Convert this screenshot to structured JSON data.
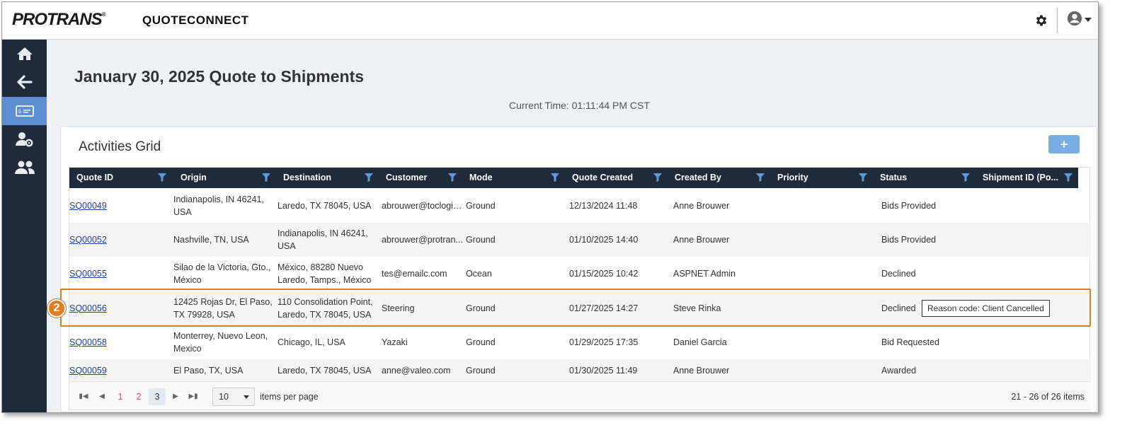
{
  "app": {
    "logo": "PROTRANS",
    "logo_mark": "®",
    "title": "QUOTECONNECT"
  },
  "page": {
    "title": "January 30, 2025 Quote to Shipments",
    "current_time": "Current Time: 01:11:44 PM CST"
  },
  "sidebar": {
    "items": [
      {
        "icon": "home-icon"
      },
      {
        "icon": "arrow-left-icon"
      },
      {
        "icon": "quote-card-icon",
        "active": true
      },
      {
        "icon": "user-settings-icon"
      },
      {
        "icon": "users-icon"
      }
    ]
  },
  "grid": {
    "title": "Activities Grid",
    "add_label": "+",
    "columns": [
      "Quote ID",
      "Origin",
      "Destination",
      "Customer",
      "Mode",
      "Quote Created",
      "Created By",
      "Priority",
      "Status",
      "Shipment ID (Po..."
    ],
    "rows": [
      {
        "quote_id": "SQ00049",
        "origin": "Indianapolis, IN 46241, USA",
        "destination": "Laredo, TX 78045, USA",
        "customer": "abrouwer@toclogis...",
        "mode": "Ground",
        "quote_created": "12/13/2024 11:48",
        "created_by": "Anne Brouwer",
        "priority": "",
        "status": "Bids Provided",
        "shipment_id": ""
      },
      {
        "quote_id": "SQ00052",
        "origin": "Nashville, TN, USA",
        "destination": "Indianapolis, IN 46241, USA",
        "customer": "abrouwer@protran...",
        "mode": "Ground",
        "quote_created": "01/10/2025 14:40",
        "created_by": "Anne Brouwer",
        "priority": "",
        "status": "Bids Provided",
        "shipment_id": ""
      },
      {
        "quote_id": "SQ00055",
        "origin": "Silao de la Victoria, Gto., México",
        "destination": "México, 88280 Nuevo Laredo, Tamps., México",
        "customer": "tes@emailc.com",
        "mode": "Ocean",
        "quote_created": "01/15/2025 10:42",
        "created_by": "ASPNET Admin",
        "priority": "",
        "status": "Declined",
        "shipment_id": ""
      },
      {
        "quote_id": "SQ00056",
        "origin": "12425 Rojas Dr, El Paso, TX 79928, USA",
        "destination": "110 Consolidation Point, Laredo, TX 78045, USA",
        "customer": "Steering",
        "mode": "Ground",
        "quote_created": "01/27/2025 14:27",
        "created_by": "Steve Rinka",
        "priority": "",
        "status": "Declined",
        "shipment_id": "",
        "tooltip": "Reason code: Client Cancelled"
      },
      {
        "quote_id": "SQ00058",
        "origin": "Monterrey, Nuevo Leon, Mexico",
        "destination": "Chicago, IL, USA",
        "customer": "Yazaki",
        "mode": "Ground",
        "quote_created": "01/29/2025 17:35",
        "created_by": "Daniel Garcia",
        "priority": "",
        "status": "Bid Requested",
        "shipment_id": ""
      },
      {
        "quote_id": "SQ00059",
        "origin": "El Paso, TX, USA",
        "destination": "Laredo, TX 78045, USA",
        "customer": "anne@valeo.com",
        "mode": "Ground",
        "quote_created": "01/30/2025 11:49",
        "created_by": "Anne Brouwer",
        "priority": "",
        "status": "Awarded",
        "shipment_id": ""
      }
    ]
  },
  "pager": {
    "pages": [
      "1",
      "2",
      "3"
    ],
    "current_page": "3",
    "page_size": "10",
    "per_page_label": "items per page",
    "range": "21 - 26 of 26 items"
  },
  "callout": {
    "number": "2",
    "color": "#e07d22"
  },
  "colors": {
    "sidebar": "#1f2a3a",
    "accent": "#5c8fd1",
    "link": "#1a3fb0",
    "highlight": "#e07d22"
  }
}
